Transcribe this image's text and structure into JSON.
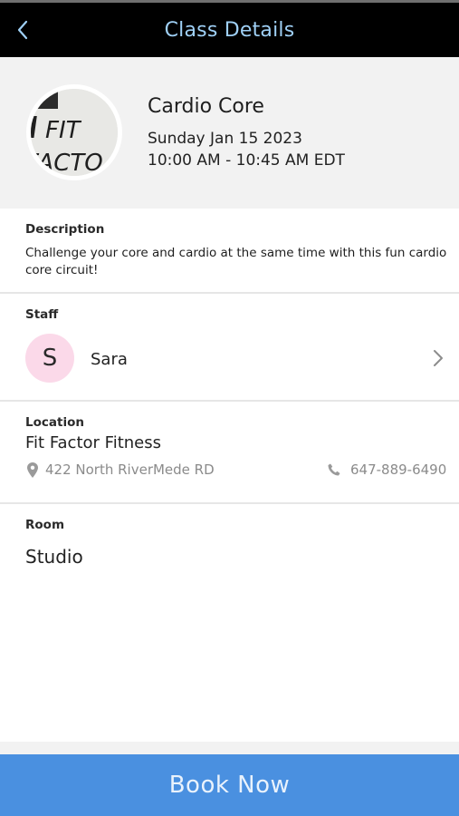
{
  "header": {
    "title": "Class Details"
  },
  "class": {
    "logo_text_line1": "FIT",
    "logo_text_line2": "FACTO",
    "name": "Cardio Core",
    "date": "Sunday Jan 15 2023",
    "time": "10:00 AM - 10:45 AM EDT"
  },
  "description": {
    "label": "Description",
    "text": "Challenge your core and cardio at the same time with this fun cardio core circuit!"
  },
  "staff": {
    "label": "Staff",
    "initial": "S",
    "name": "Sara"
  },
  "location": {
    "label": "Location",
    "name": "Fit Factor Fitness",
    "address": "422 North RiverMede RD",
    "phone": "647-889-6490"
  },
  "room": {
    "label": "Room",
    "value": "Studio"
  },
  "actions": {
    "book_label": "Book Now"
  },
  "colors": {
    "header_bg": "#000000",
    "title_color": "#9fd0f6",
    "card_bg": "#f2f2f2",
    "avatar_bg": "#fbd9e9",
    "button_bg": "#4a90e0"
  },
  "icons": {
    "back": "chevron-left-icon",
    "staff_chevron": "chevron-right-icon",
    "address": "map-pin-icon",
    "phone": "phone-icon"
  }
}
